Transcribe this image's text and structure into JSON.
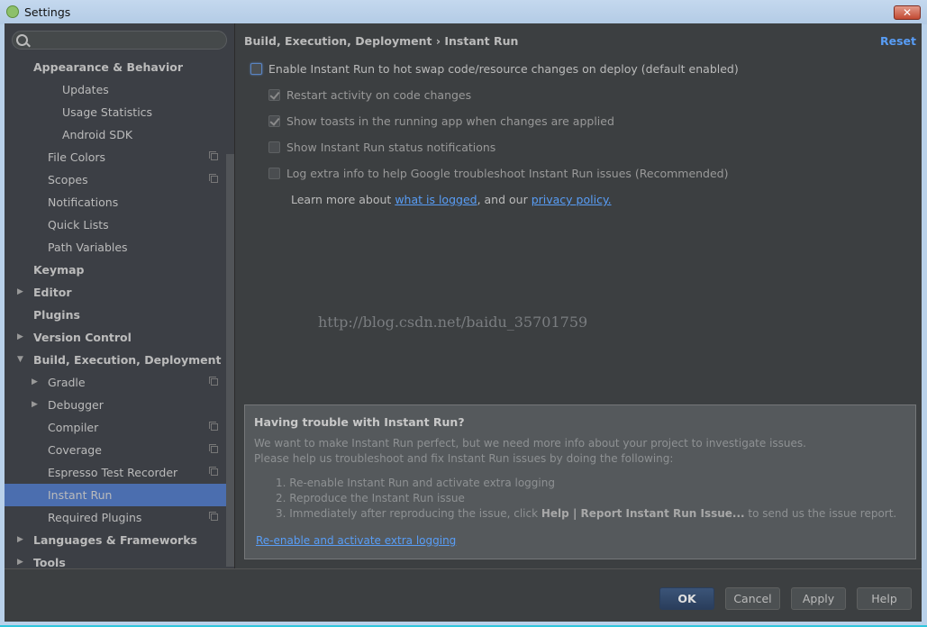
{
  "window": {
    "title": "Settings",
    "close_label": "✕"
  },
  "sidebar": {
    "search": {
      "placeholder": "",
      "value": ""
    },
    "items": [
      {
        "label": "Appearance & Behavior",
        "level": 0,
        "bold": true,
        "arrow": "",
        "proj": false
      },
      {
        "label": "Updates",
        "level": 2,
        "bold": false,
        "arrow": "",
        "proj": false
      },
      {
        "label": "Usage Statistics",
        "level": 2,
        "bold": false,
        "arrow": "",
        "proj": false
      },
      {
        "label": "Android SDK",
        "level": 2,
        "bold": false,
        "arrow": "",
        "proj": false
      },
      {
        "label": "File Colors",
        "level": 1,
        "bold": false,
        "arrow": "",
        "proj": true
      },
      {
        "label": "Scopes",
        "level": 1,
        "bold": false,
        "arrow": "",
        "proj": true
      },
      {
        "label": "Notifications",
        "level": 1,
        "bold": false,
        "arrow": "",
        "proj": false
      },
      {
        "label": "Quick Lists",
        "level": 1,
        "bold": false,
        "arrow": "",
        "proj": false
      },
      {
        "label": "Path Variables",
        "level": 1,
        "bold": false,
        "arrow": "",
        "proj": false
      },
      {
        "label": "Keymap",
        "level": 0,
        "bold": true,
        "arrow": "",
        "proj": false
      },
      {
        "label": "Editor",
        "level": 0,
        "bold": true,
        "arrow": "right",
        "proj": false
      },
      {
        "label": "Plugins",
        "level": 0,
        "bold": true,
        "arrow": "",
        "proj": false
      },
      {
        "label": "Version Control",
        "level": 0,
        "bold": true,
        "arrow": "right",
        "proj": false
      },
      {
        "label": "Build, Execution, Deployment",
        "level": 0,
        "bold": true,
        "arrow": "down",
        "proj": false
      },
      {
        "label": "Gradle",
        "level": 1,
        "bold": false,
        "arrow": "right",
        "proj": true
      },
      {
        "label": "Debugger",
        "level": 1,
        "bold": false,
        "arrow": "right",
        "proj": false
      },
      {
        "label": "Compiler",
        "level": 1,
        "bold": false,
        "arrow": "",
        "proj": true
      },
      {
        "label": "Coverage",
        "level": 1,
        "bold": false,
        "arrow": "",
        "proj": true
      },
      {
        "label": "Espresso Test Recorder",
        "level": 1,
        "bold": false,
        "arrow": "",
        "proj": true
      },
      {
        "label": "Instant Run",
        "level": 1,
        "bold": false,
        "arrow": "",
        "proj": false,
        "selected": true
      },
      {
        "label": "Required Plugins",
        "level": 1,
        "bold": false,
        "arrow": "",
        "proj": true
      },
      {
        "label": "Languages & Frameworks",
        "level": 0,
        "bold": true,
        "arrow": "right",
        "proj": false
      },
      {
        "label": "Tools",
        "level": 0,
        "bold": true,
        "arrow": "right",
        "proj": false
      }
    ]
  },
  "main": {
    "breadcrumb": {
      "parent": "Build, Execution, Deployment",
      "separator": "›",
      "current": "Instant Run"
    },
    "reset_label": "Reset",
    "options": {
      "enable": {
        "label": "Enable Instant Run to hot swap code/resource changes on deploy (default enabled)",
        "checked": false
      },
      "restart": {
        "label": "Restart activity on code changes",
        "checked": true
      },
      "toasts": {
        "label": "Show toasts in the running app when changes are applied",
        "checked": true
      },
      "status": {
        "label": "Show Instant Run status notifications",
        "checked": false
      },
      "log": {
        "label": "Log extra info to help Google troubleshoot Instant Run issues (Recommended)",
        "checked": false
      }
    },
    "learn_more": {
      "prefix": "Learn more about ",
      "link1": "what is logged",
      "middle": ", and our ",
      "link2": "privacy policy."
    },
    "watermark": "http://blog.csdn.net/baidu_35701759",
    "trouble": {
      "title": "Having trouble with Instant Run?",
      "line1": "We want to make Instant Run perfect, but we need more info about your project to investigate issues.",
      "line2": "Please help us troubleshoot and fix Instant Run issues by doing the following:",
      "step1": "1. Re-enable Instant Run and activate extra logging",
      "step2": "2. Reproduce the Instant Run issue",
      "step3_prefix": "3. Immediately after reproducing the issue, click ",
      "step3_bold": "Help | Report Instant Run Issue...",
      "step3_suffix": " to send us the issue report.",
      "link": "Re-enable and activate extra logging"
    }
  },
  "footer": {
    "ok": "OK",
    "cancel": "Cancel",
    "apply": "Apply",
    "help": "Help"
  },
  "colors": {
    "accent": "#589df6",
    "selection": "#4b6eaf",
    "background": "#3c3f41"
  }
}
